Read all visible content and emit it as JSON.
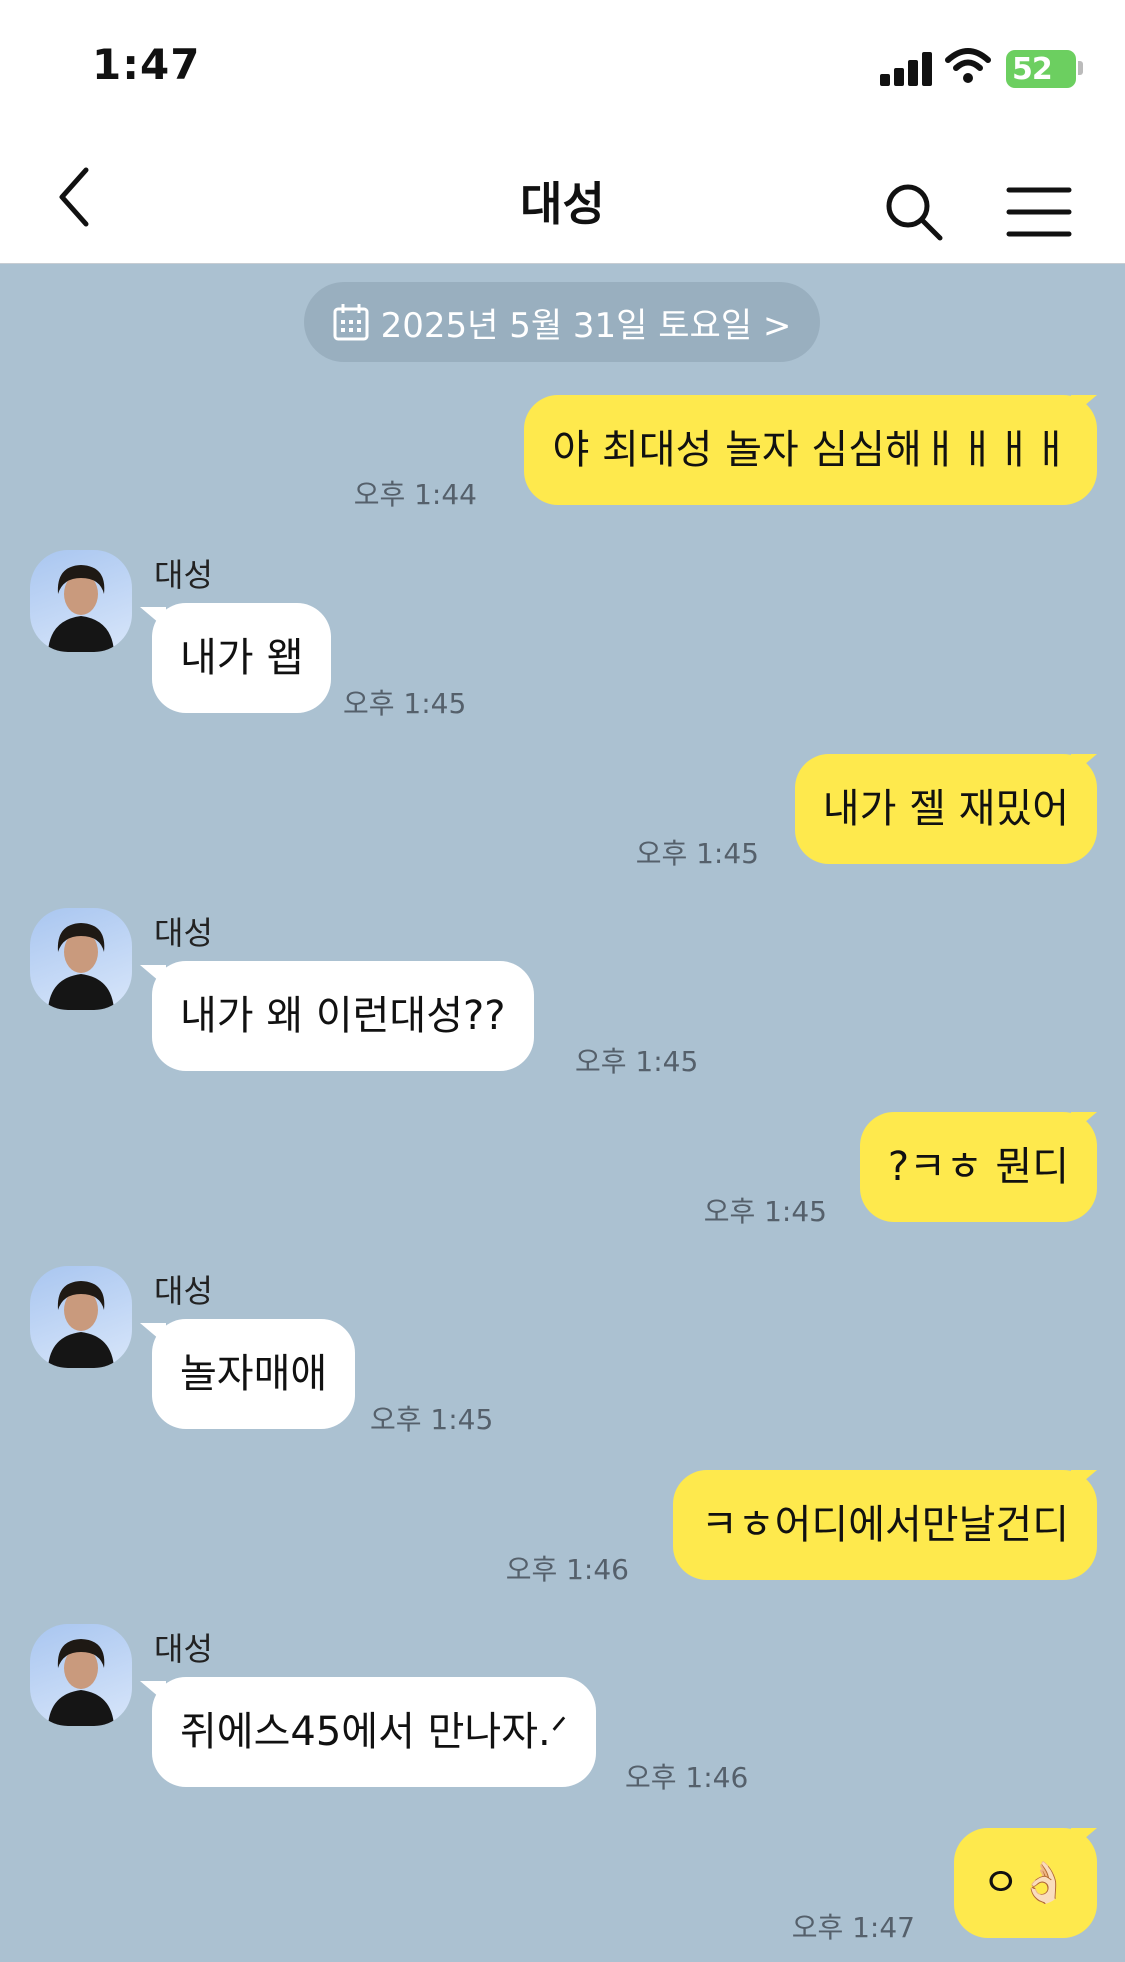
{
  "status_bar": {
    "time": "1:47",
    "battery": "52"
  },
  "header": {
    "title": "대성"
  },
  "date_chip": {
    "label": "2025년 5월 31일 토요일 >"
  },
  "messages": [
    {
      "from": "me",
      "text": "야 최대성 놀자 심심해ㅐㅐㅐㅐ",
      "time": "오후 1:44"
    },
    {
      "from": "friend",
      "sender": "대성",
      "text": "내가 왭",
      "time": "오후 1:45"
    },
    {
      "from": "me",
      "text": "내가 젤 재밌어",
      "time": "오후 1:45"
    },
    {
      "from": "friend",
      "sender": "대성",
      "text": "내가 왜 이런대성??",
      "time": "오후 1:45"
    },
    {
      "from": "me",
      "text": "?ㅋㅎ 뭔디",
      "time": "오후 1:45"
    },
    {
      "from": "friend",
      "sender": "대성",
      "text": "놀자매애",
      "time": "오후 1:45"
    },
    {
      "from": "me",
      "text": "ㅋㅎ어디에서만날건디",
      "time": "오후 1:46"
    },
    {
      "from": "friend",
      "sender": "대성",
      "text": "쥐에스45에서 만나자.ᐟ",
      "time": "오후 1:46"
    },
    {
      "from": "me",
      "text": "ㅇ👌🏻",
      "time": "오후 1:47"
    }
  ]
}
